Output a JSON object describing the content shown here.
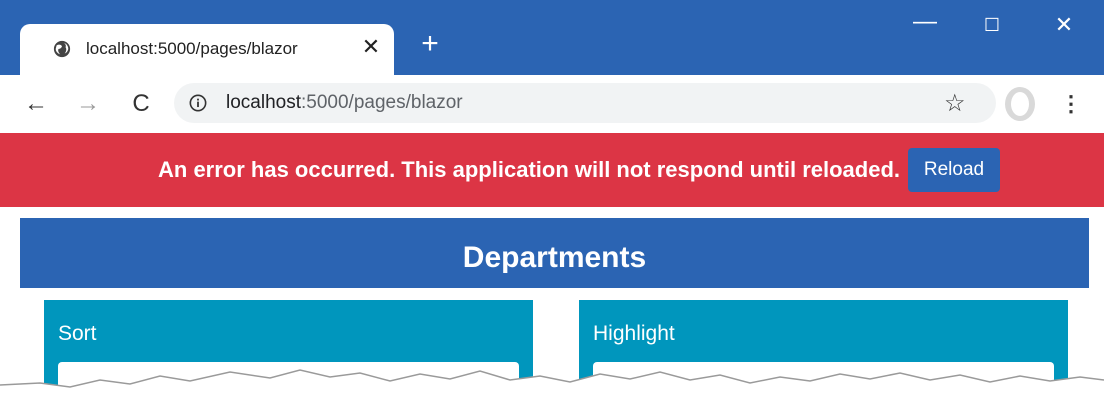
{
  "browser": {
    "tab_title": "localhost:5000/pages/blazor",
    "tab_close": "✕",
    "new_tab": "+",
    "minimize": "—",
    "maximize": "☐",
    "close": "✕",
    "back": "←",
    "forward": "→",
    "reload": "C",
    "url_host": "localhost",
    "url_path": ":5000/pages/blazor",
    "bookmark": "☆",
    "menu": "⋮"
  },
  "error_bar": {
    "message": "An error has occurred. This application will not respond until reloaded.",
    "reload_label": "Reload"
  },
  "page": {
    "header": "Departments",
    "cards": [
      {
        "label": "Sort"
      },
      {
        "label": "Highlight"
      }
    ]
  },
  "colors": {
    "chrome_blue": "#2b64b3",
    "error_red": "#dc3545",
    "card_teal": "#0096bd"
  }
}
